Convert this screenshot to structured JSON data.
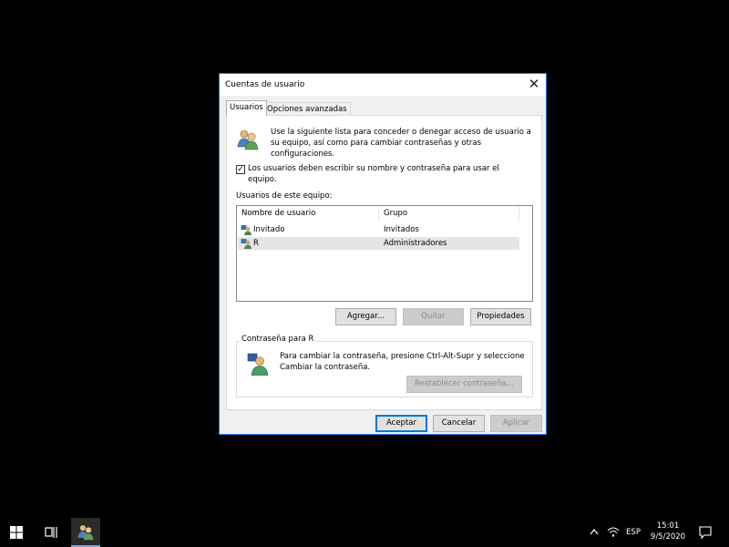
{
  "dialog": {
    "title": "Cuentas de usuario",
    "close_glyph": "✕",
    "tabs": [
      {
        "label": "Usuarios",
        "active": true
      },
      {
        "label": "Opciones avanzadas",
        "active": false
      }
    ],
    "description": "Use la siguiente lista para conceder o denegar acceso de usuario a su equipo, así como para cambiar contraseñas y otras configuraciones.",
    "require_login": {
      "checked": true,
      "label": "Los usuarios deben escribir su nombre y contraseña para usar el equipo."
    },
    "users_label": "Usuarios de este equipo:",
    "users_table": {
      "columns": [
        "Nombre de usuario",
        "Grupo"
      ],
      "rows": [
        {
          "name": "Invitado",
          "group": "Invitados",
          "selected": false
        },
        {
          "name": "R",
          "group": "Administradores",
          "selected": true
        }
      ]
    },
    "buttons": {
      "add": "Agregar...",
      "remove": "Quitar",
      "properties": "Propiedades"
    },
    "password_group": {
      "title": "Contraseña para R",
      "text": "Para cambiar la contraseña, presione Ctrl-Alt-Supr y seleccione Cambiar la contraseña.",
      "reset_button": "Restablecer contraseña..."
    },
    "footer": {
      "ok": "Aceptar",
      "cancel": "Cancelar",
      "apply": "Aplicar"
    }
  },
  "taskbar": {
    "language": "ESP",
    "time": "15:01",
    "date": "9/5/2020",
    "icons": [
      "windows-start-icon",
      "task-view-icon",
      "user-accounts-app-icon",
      "chevron-up-icon",
      "network-icon",
      "notifications-icon"
    ]
  },
  "colors": {
    "accent": "#0078d7",
    "dialog_border": "#1e78d2",
    "desktop": "#000000"
  }
}
